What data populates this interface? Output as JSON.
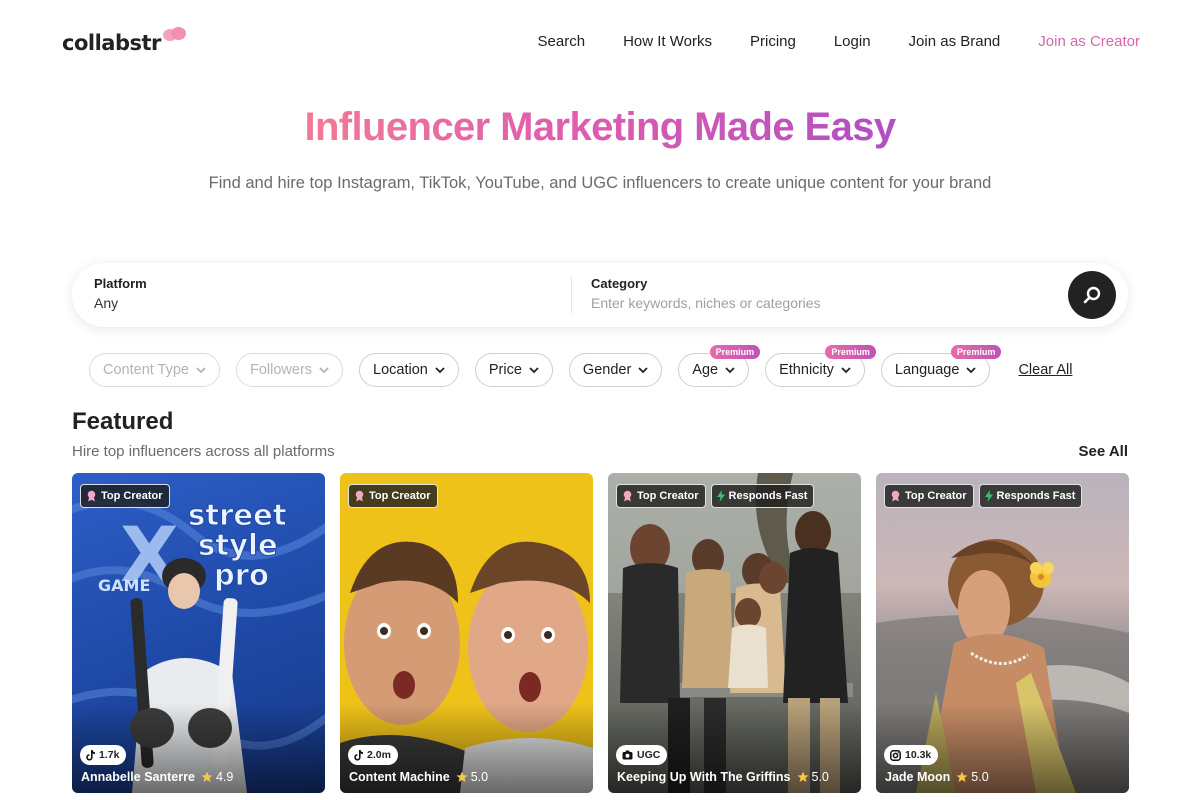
{
  "brand": {
    "name": "collabstr"
  },
  "nav": {
    "search": "Search",
    "how_it_works": "How It Works",
    "pricing": "Pricing",
    "login": "Login",
    "join_brand": "Join as Brand",
    "join_creator": "Join as Creator"
  },
  "hero": {
    "title": "Influencer Marketing Made Easy",
    "subtitle": "Find and hire top Instagram, TikTok, YouTube, and UGC influencers to create unique content for your brand"
  },
  "search": {
    "platform_label": "Platform",
    "platform_value": "Any",
    "category_label": "Category",
    "category_placeholder": "Enter keywords, niches or categories"
  },
  "filters": {
    "content_type": "Content Type",
    "followers": "Followers",
    "location": "Location",
    "price": "Price",
    "gender": "Gender",
    "age": "Age",
    "ethnicity": "Ethnicity",
    "language": "Language",
    "premium_badge": "Premium",
    "clear_all": "Clear All"
  },
  "featured": {
    "title": "Featured",
    "subtitle": "Hire top influencers across all platforms",
    "see_all": "See All",
    "cards": [
      {
        "badges": [
          "Top Creator"
        ],
        "platform": "tiktok",
        "stat": "1.7k",
        "name": "Annabelle Santerre",
        "rating": "4.9"
      },
      {
        "badges": [
          "Top Creator"
        ],
        "platform": "tiktok",
        "stat": "2.0m",
        "name": "Content Machine",
        "rating": "5.0"
      },
      {
        "badges": [
          "Top Creator",
          "Responds Fast"
        ],
        "platform": "ugc",
        "stat": "UGC",
        "name": "Keeping Up With The Griffins",
        "rating": "5.0"
      },
      {
        "badges": [
          "Top Creator",
          "Responds Fast"
        ],
        "platform": "instagram",
        "stat": "10.3k",
        "name": "Jade Moon",
        "rating": "5.0"
      }
    ]
  },
  "colors": {
    "accent_pink": "#d468a8",
    "gradient_start": "#f27a94",
    "gradient_end": "#b04fc4",
    "dark": "#222222"
  }
}
